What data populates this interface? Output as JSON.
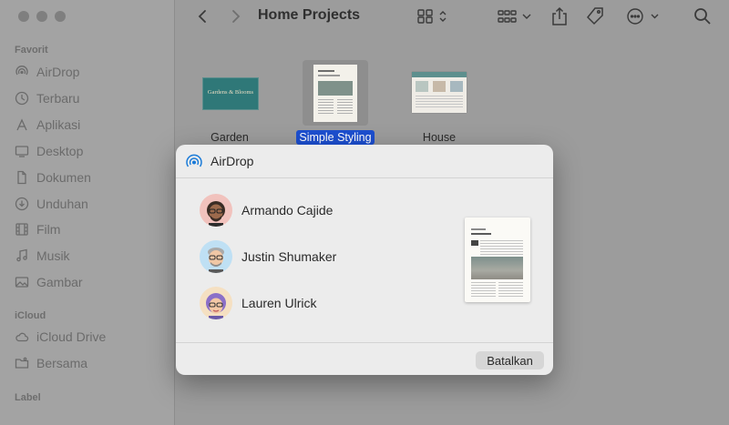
{
  "toolbar": {
    "title": "Home Projects"
  },
  "sidebar": {
    "favorites_header": "Favorit",
    "favorites": [
      {
        "label": "AirDrop",
        "icon": "airdrop-icon"
      },
      {
        "label": "Terbaru",
        "icon": "clock-icon"
      },
      {
        "label": "Aplikasi",
        "icon": "applications-icon"
      },
      {
        "label": "Desktop",
        "icon": "desktop-icon"
      },
      {
        "label": "Dokumen",
        "icon": "document-icon"
      },
      {
        "label": "Unduhan",
        "icon": "download-icon"
      },
      {
        "label": "Film",
        "icon": "film-icon"
      },
      {
        "label": "Musik",
        "icon": "music-icon"
      },
      {
        "label": "Gambar",
        "icon": "picture-icon"
      }
    ],
    "icloud_header": "iCloud",
    "icloud": [
      {
        "label": "iCloud Drive",
        "icon": "cloud-icon"
      },
      {
        "label": "Bersama",
        "icon": "shared-folder-icon"
      }
    ],
    "label_header": "Label"
  },
  "files": [
    {
      "name": "Garden",
      "selected": false
    },
    {
      "name": "Simple Styling",
      "selected": true
    },
    {
      "name": "House",
      "selected": false
    }
  ],
  "thumbnails": {
    "garden_text": "Gardens & Blooms"
  },
  "airdrop": {
    "title": "AirDrop",
    "people": [
      {
        "name": "Armando Cajide"
      },
      {
        "name": "Justin Shumaker"
      },
      {
        "name": "Lauren Ulrick"
      }
    ],
    "cancel_label": "Batalkan"
  },
  "colors": {
    "selection": "#1d4fcf",
    "dialog_bg": "#ececec",
    "sidebar_bg": "#a3a3a3"
  }
}
